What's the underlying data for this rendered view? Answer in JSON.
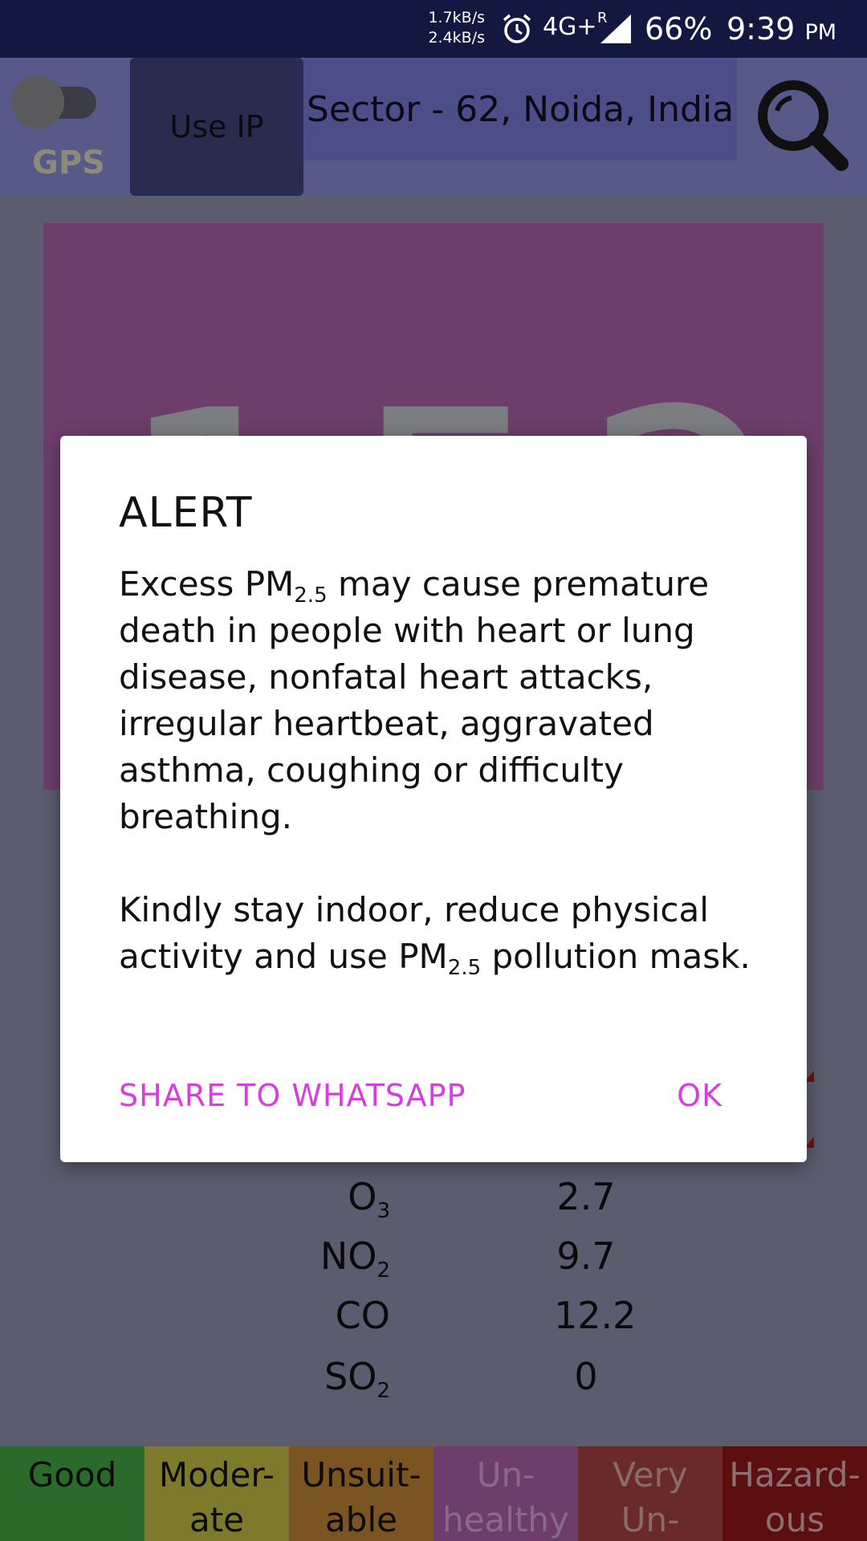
{
  "status_bar": {
    "upload_speed": "1.7kB/s",
    "download_speed": "2.4kB/s",
    "network": "4G+",
    "roaming": "R",
    "battery": "66%",
    "time": "9:39",
    "ampm": "PM"
  },
  "toolbar": {
    "gps_label": "GPS",
    "gps_enabled": false,
    "use_ip_label": "Use IP",
    "location": "Sector - 62, Noida, India"
  },
  "aqi": {
    "value": "152",
    "color": "#6d3e6c"
  },
  "pollutants": [
    {
      "name": "O",
      "sub": "3",
      "value": "2.7"
    },
    {
      "name": "NO",
      "sub": "2",
      "value": "9.7"
    },
    {
      "name": "CO",
      "sub": "",
      "value": "12.2"
    },
    {
      "name": "SO",
      "sub": "2",
      "value": "0"
    }
  ],
  "legend": [
    {
      "line1": "Good",
      "line2": "",
      "bg": "#2c6a2b",
      "fg": "#0c0c0c"
    },
    {
      "line1": "Moder-",
      "line2": "ate",
      "bg": "#7d7a2c",
      "fg": "#0c0c0c"
    },
    {
      "line1": "Unsuit-",
      "line2": "able",
      "bg": "#7a5421",
      "fg": "#0c0c0c"
    },
    {
      "line1": "Un-",
      "line2": "healthy",
      "bg": "#6d3e6c",
      "fg": "#8a6a88"
    },
    {
      "line1": "Very",
      "line2": "Un-",
      "bg": "#6a2a2c",
      "fg": "#8a6a6a"
    },
    {
      "line1": "Hazard-",
      "line2": "ous",
      "bg": "#5c0f10",
      "fg": "#8a7070"
    }
  ],
  "dialog": {
    "title": "ALERT",
    "p1_a": "Excess PM",
    "p1_sub": "2.5",
    "p1_b": " may cause premature death in people with heart or lung disease, nonfatal heart attacks, irregular heartbeat, aggravated asthma, coughing or difficulty breathing.",
    "p2_a": "Kindly stay indoor, reduce physical activity and use PM",
    "p2_sub": "2.5",
    "p2_b": " pollution mask.",
    "share_label": "SHARE TO WHATSAPP",
    "ok_label": "OK"
  },
  "colors": {
    "accent": "#d63ee0",
    "status_bar": "#131840"
  }
}
